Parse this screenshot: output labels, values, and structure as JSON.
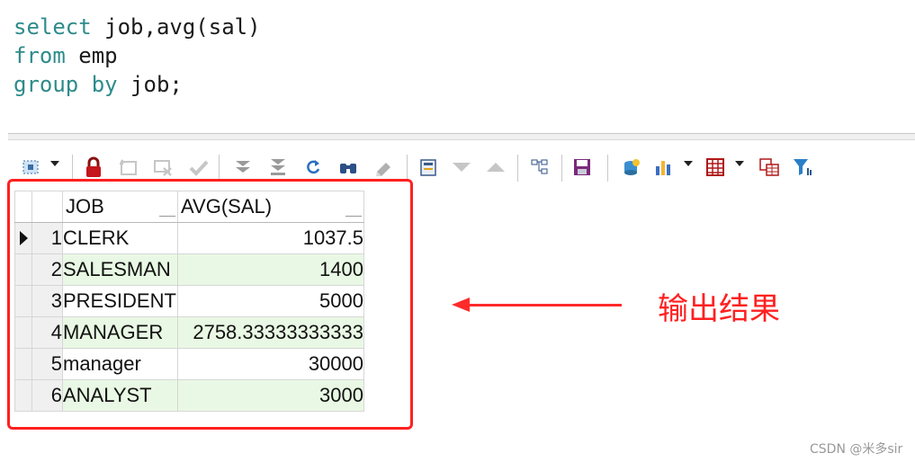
{
  "editor": {
    "line1_kw": "select",
    "line1_rest": " job,avg(sal)",
    "line2_kw": "from",
    "line2_rest": " emp",
    "line3_kw": "group by",
    "line3_rest": " job;"
  },
  "toolbar": {
    "icons": [
      "select-rows-icon",
      "lock-icon",
      "insert-record-icon",
      "delete-record-icon",
      "post-changes-icon",
      "fetch-next-icon",
      "fetch-last-icon",
      "refresh-icon",
      "find-icon",
      "clear-icon",
      "single-record-view-icon",
      "previous-record-icon",
      "next-record-icon",
      "query-by-example-icon",
      "save-icon",
      "export-icon",
      "chart-icon",
      "grid-layout-icon",
      "table-compare-icon",
      "filter-icon"
    ]
  },
  "grid": {
    "columns": [
      "JOB",
      "AVG(SAL)"
    ],
    "rows": [
      {
        "n": "1",
        "job": "CLERK",
        "avg": "1037.5"
      },
      {
        "n": "2",
        "job": "SALESMAN",
        "avg": "1400"
      },
      {
        "n": "3",
        "job": "PRESIDENT",
        "avg": "5000"
      },
      {
        "n": "4",
        "job": "MANAGER",
        "avg": "2758.33333333333"
      },
      {
        "n": "5",
        "job": "manager",
        "avg": "30000"
      },
      {
        "n": "6",
        "job": "ANALYST",
        "avg": "3000"
      }
    ],
    "alt_row_color": "#e9f8e4"
  },
  "annotation": {
    "text": "输出结果",
    "color": "#ff2020"
  },
  "watermark": "CSDN @米多sir"
}
